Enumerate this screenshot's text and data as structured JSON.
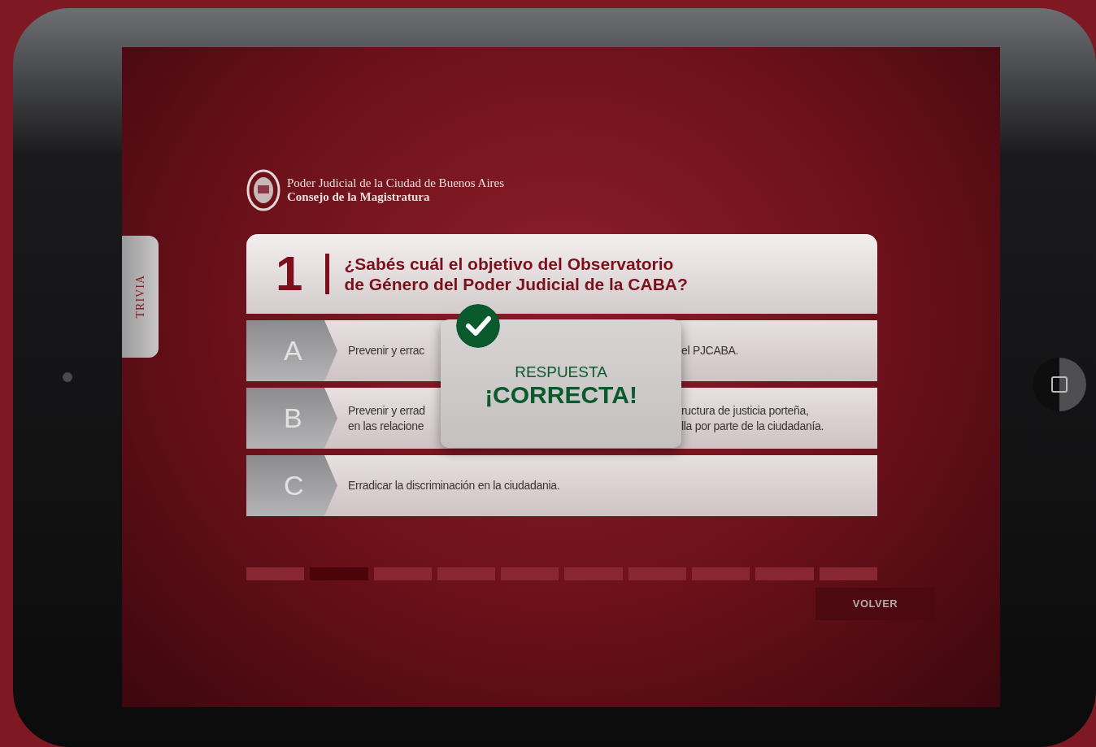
{
  "side_tab": {
    "label": "TRIVIA"
  },
  "header": {
    "line_1": "Poder Judicial de la Ciudad de Buenos Aires",
    "line_2": "Consejo de la Magistratura"
  },
  "question": {
    "number": "1",
    "text": "¿Sabés cuál el objetivo del Observatorio\nde Género del Poder Judicial de la CABA?"
  },
  "options": [
    {
      "letter": "A",
      "text_left": "Prevenir y errac",
      "text_right": "el PJCABA."
    },
    {
      "letter": "B",
      "text_left": "Prevenir y errad\nen las relacione",
      "text_right": "ructura de justicia porteña,\nlla por parte de la ciudadanía."
    },
    {
      "letter": "C",
      "text_left": "Erradicar la discriminación en la ciudadania."
    }
  ],
  "result": {
    "label": "RESPUESTA",
    "verdict": "¡CORRECTA!",
    "correct": true
  },
  "progress": [
    {
      "selected": false
    },
    {
      "selected": true
    },
    {
      "selected": false
    },
    {
      "selected": false
    },
    {
      "selected": false
    },
    {
      "selected": false
    },
    {
      "selected": false
    },
    {
      "selected": false
    },
    {
      "selected": false
    },
    {
      "selected": false
    }
  ],
  "back_button": {
    "label": "VOLVER"
  }
}
